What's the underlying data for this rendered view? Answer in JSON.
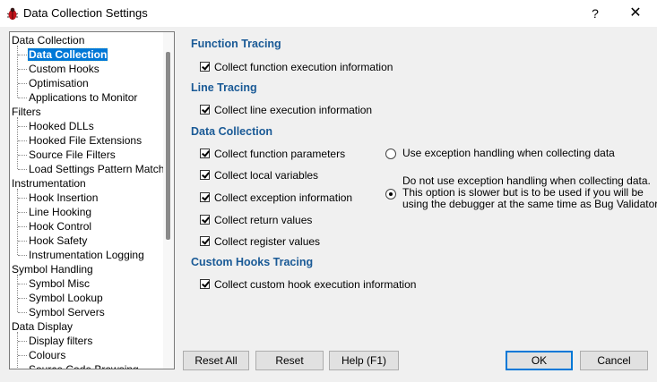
{
  "window": {
    "title": "Data Collection Settings",
    "help_glyph": "?",
    "close_glyph": "✕"
  },
  "tree": {
    "items": [
      {
        "label": "Data Collection",
        "level": 0
      },
      {
        "label": "Data Collection",
        "level": 1,
        "selected": true
      },
      {
        "label": "Custom Hooks",
        "level": 1
      },
      {
        "label": "Optimisation",
        "level": 1
      },
      {
        "label": "Applications to Monitor",
        "level": 1
      },
      {
        "label": "Filters",
        "level": 0
      },
      {
        "label": "Hooked DLLs",
        "level": 1
      },
      {
        "label": "Hooked File Extensions",
        "level": 1
      },
      {
        "label": "Source File Filters",
        "level": 1
      },
      {
        "label": "Load Settings Pattern Match",
        "level": 1
      },
      {
        "label": "Instrumentation",
        "level": 0
      },
      {
        "label": "Hook Insertion",
        "level": 1
      },
      {
        "label": "Line Hooking",
        "level": 1
      },
      {
        "label": "Hook Control",
        "level": 1
      },
      {
        "label": "Hook Safety",
        "level": 1
      },
      {
        "label": "Instrumentation Logging",
        "level": 1
      },
      {
        "label": "Symbol Handling",
        "level": 0
      },
      {
        "label": "Symbol Misc",
        "level": 1
      },
      {
        "label": "Symbol Lookup",
        "level": 1
      },
      {
        "label": "Symbol Servers",
        "level": 1
      },
      {
        "label": "Data Display",
        "level": 0
      },
      {
        "label": "Display filters",
        "level": 1
      },
      {
        "label": "Colours",
        "level": 1
      },
      {
        "label": "Source Code Browsing",
        "level": 1
      }
    ]
  },
  "sections": {
    "function_tracing": "Function Tracing",
    "line_tracing": "Line Tracing",
    "data_collection": "Data Collection",
    "custom_hooks_tracing": "Custom Hooks Tracing"
  },
  "checkboxes": {
    "collect_function_execution": "Collect function execution information",
    "collect_line_execution": "Collect line execution information",
    "collect_function_parameters": "Collect function parameters",
    "collect_local_variables": "Collect local variables",
    "collect_exception_information": "Collect exception information",
    "collect_return_values": "Collect return values",
    "collect_register_values": "Collect register values",
    "collect_custom_hook_execution": "Collect custom hook execution information"
  },
  "radios": {
    "use_exception_handling": "Use exception handling when collecting data",
    "no_exception_line1": "Do not use exception handling when collecting data.",
    "no_exception_line2": "This option is slower but is to be used if you will be",
    "no_exception_line3": "using the debugger at the same time as Bug Validator."
  },
  "buttons": {
    "reset_all": "Reset All",
    "reset": "Reset",
    "help": "Help (F1)",
    "ok": "OK",
    "cancel": "Cancel"
  }
}
